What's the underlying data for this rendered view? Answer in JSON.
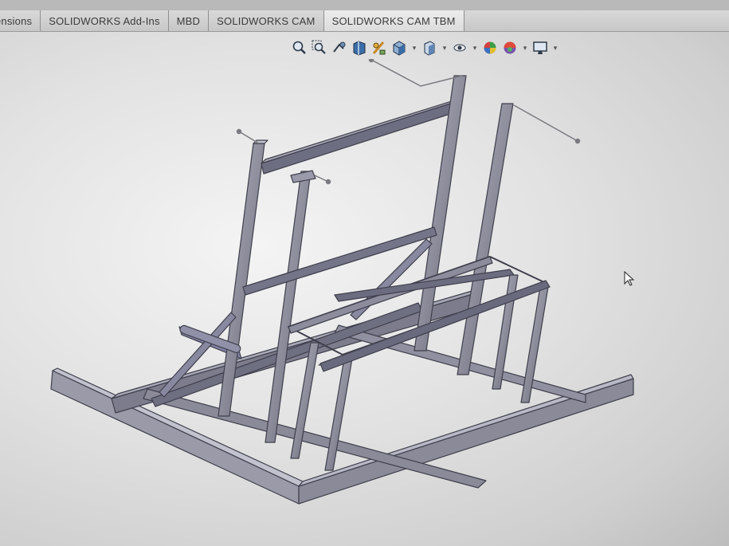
{
  "command_manager": {
    "tabs": [
      {
        "label": "ensions"
      },
      {
        "label": "SOLIDWORKS Add-Ins"
      },
      {
        "label": "MBD"
      },
      {
        "label": "SOLIDWORKS CAM"
      },
      {
        "label": "SOLIDWORKS CAM TBM"
      }
    ]
  },
  "heads_up_toolbar": {
    "icons": [
      "zoom-to-fit-icon",
      "zoom-to-area-icon",
      "previous-view-icon",
      "section-view-icon",
      "dynamic-annotation-view-icon",
      "view-orientation-icon",
      "display-style-icon",
      "hide-show-items-icon",
      "edit-appearance-icon",
      "apply-scene-icon",
      "view-settings-icon"
    ]
  },
  "model": {
    "type": "weldment steel frame",
    "colors": {
      "steel_light": "#a9a9b7",
      "steel_dark": "#5b5b6b",
      "steel_edge": "#3f3f4d",
      "dim_line": "#7a7a80"
    }
  }
}
